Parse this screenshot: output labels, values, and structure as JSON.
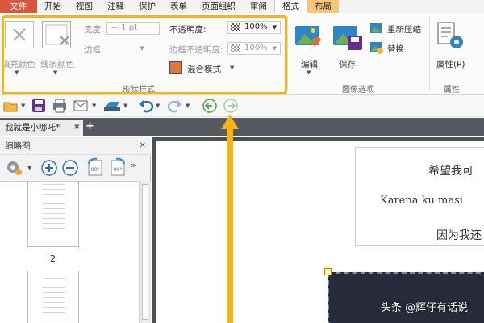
{
  "menu": {
    "tabs": [
      "文件",
      "开始",
      "视图",
      "注释",
      "保护",
      "表单",
      "页面组织",
      "审阅",
      "格式",
      "布局"
    ]
  },
  "ribbon": {
    "fill_color_label": "填充颜色",
    "line_color_label": "线条颜色",
    "width_label": "宽度:",
    "width_value": "— 1 pt",
    "border_label": "边框:",
    "opacity_label": "不透明度:",
    "opacity_value": "100%",
    "border_opacity_label": "边框不透明度:",
    "border_opacity_value": "100%",
    "blend_mode_label": "混合模式",
    "shape_style_group": "形状样式",
    "edit_label": "编辑",
    "save_label": "保存",
    "recompress_label": "重新压缩",
    "replace_label": "替换",
    "image_options_group": "图像选项",
    "properties_label": "属性(P)",
    "properties_group": "属性"
  },
  "document": {
    "tab_title": "我就是小哪吒",
    "tab_modified_mark": "*"
  },
  "thumbnail_panel": {
    "title": "缩略图",
    "page_number": "2"
  },
  "content": {
    "line1": "希望我可",
    "line2": "Karena ku masi",
    "line3": "因为我还"
  },
  "watermark": "头条 @辉仔有话说",
  "colors": {
    "file_tab": "#d9563f",
    "highlight": "#f5b41a",
    "tab_bar": "#555a60",
    "doc_background": "#4c4f53",
    "image_dark": "#272b3a"
  }
}
